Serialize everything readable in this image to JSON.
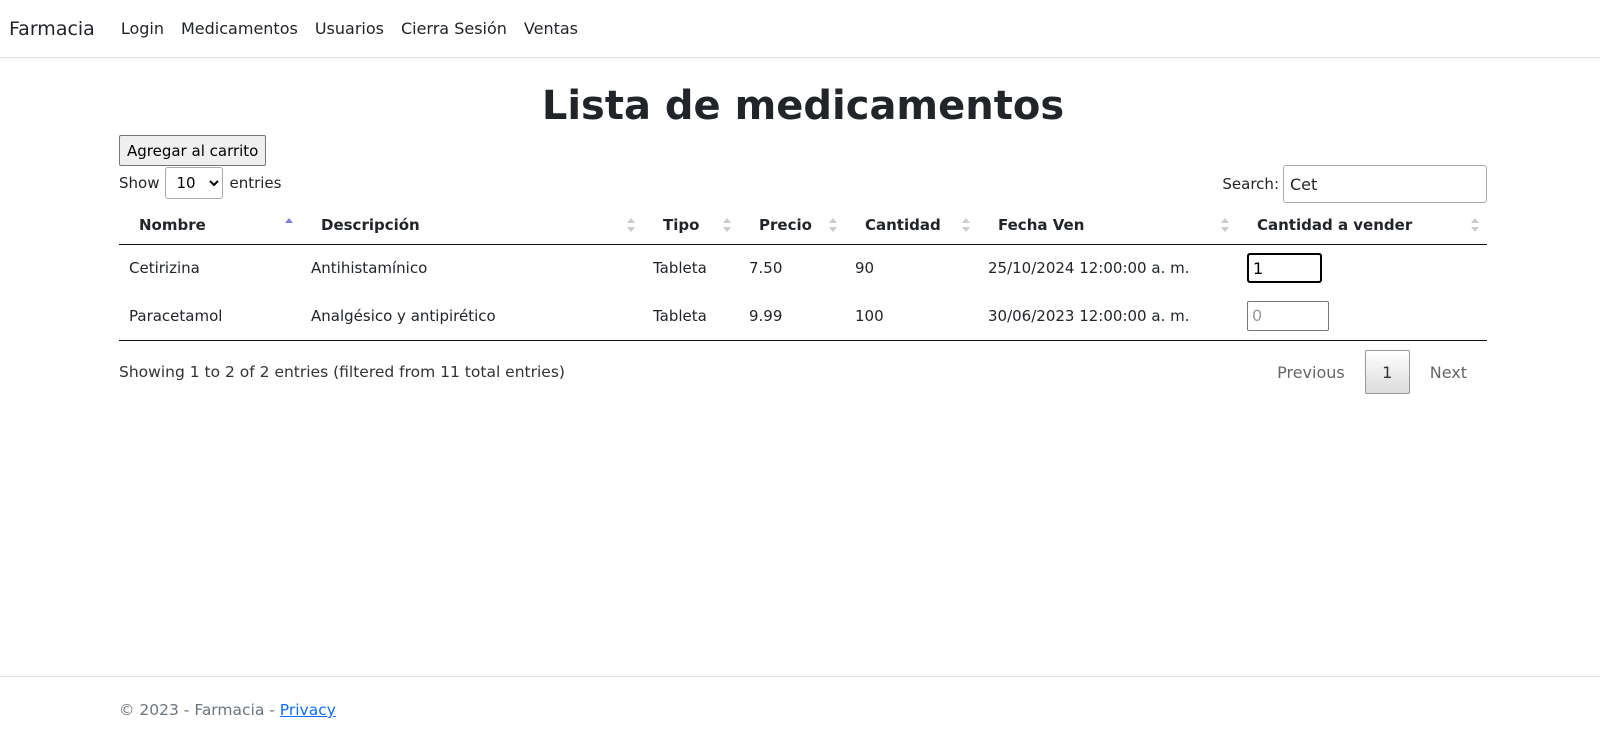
{
  "navbar": {
    "brand": "Farmacia",
    "links": [
      "Login",
      "Medicamentos",
      "Usuarios",
      "Cierra Sesión",
      "Ventas"
    ]
  },
  "page": {
    "title": "Lista de medicamentos",
    "cart_button": "Agregar al carrito"
  },
  "datatable": {
    "show_label": "Show",
    "entries_label": "entries",
    "page_length": "10",
    "search_label": "Search:",
    "search_value": "Cet",
    "columns": [
      "Nombre",
      "Descripción",
      "Tipo",
      "Precio",
      "Cantidad",
      "Fecha Ven",
      "Cantidad a vender"
    ],
    "sorted_column": "Nombre",
    "rows": [
      [
        "Cetirizina",
        "Antihistamínico",
        "Tableta",
        "7.50",
        "90",
        "25/10/2024 12:00:00 a. m.",
        "1"
      ],
      [
        "Paracetamol",
        "Analgésico y antipirético",
        "Tableta",
        "9.99",
        "100",
        "30/06/2023 12:00:00 a. m.",
        ""
      ]
    ],
    "qty_placeholder": "0",
    "info": "Showing 1 to 2 of 2 entries (filtered from 11 total entries)",
    "pagination": {
      "previous": "Previous",
      "current": "1",
      "next": "Next"
    }
  },
  "footer": {
    "text": "© 2023 - Farmacia - ",
    "privacy": "Privacy"
  },
  "colors": {
    "sort_active": "#7f7fd6",
    "sort_inactive": "#cccccc",
    "link": "#0d6efd"
  },
  "icons": [
    "sort-asc-icon",
    "sort-both-icon",
    "spinner-icon",
    "dropdown-chevron-icon"
  ]
}
